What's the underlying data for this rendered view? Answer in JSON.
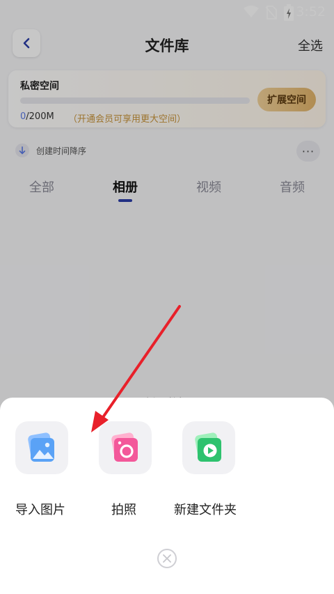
{
  "status": {
    "time": "3:52"
  },
  "header": {
    "title": "文件库",
    "select_all": "全选"
  },
  "storage": {
    "title": "私密空间",
    "used": "0",
    "total": "/200M",
    "hint": "（开通会员可享用更大空间）",
    "progress": 0,
    "expand_label": "扩展空间"
  },
  "sort": {
    "label": "创建时间降序",
    "more": "···"
  },
  "tabs": [
    {
      "label": "全部"
    },
    {
      "label": "相册"
    },
    {
      "label": "视频"
    },
    {
      "label": "音频"
    }
  ],
  "empty_hint": "暂无数据",
  "sheet": {
    "options": [
      {
        "label": "导入图片",
        "icon": "image-icon"
      },
      {
        "label": "拍照",
        "icon": "camera-icon"
      },
      {
        "label": "新建文件夹",
        "icon": "new-folder-icon"
      }
    ]
  },
  "colors": {
    "accent": "#2c3ea8",
    "progress": "#5a79e6",
    "hint": "#c9953c",
    "arrow": "#e8202a"
  }
}
